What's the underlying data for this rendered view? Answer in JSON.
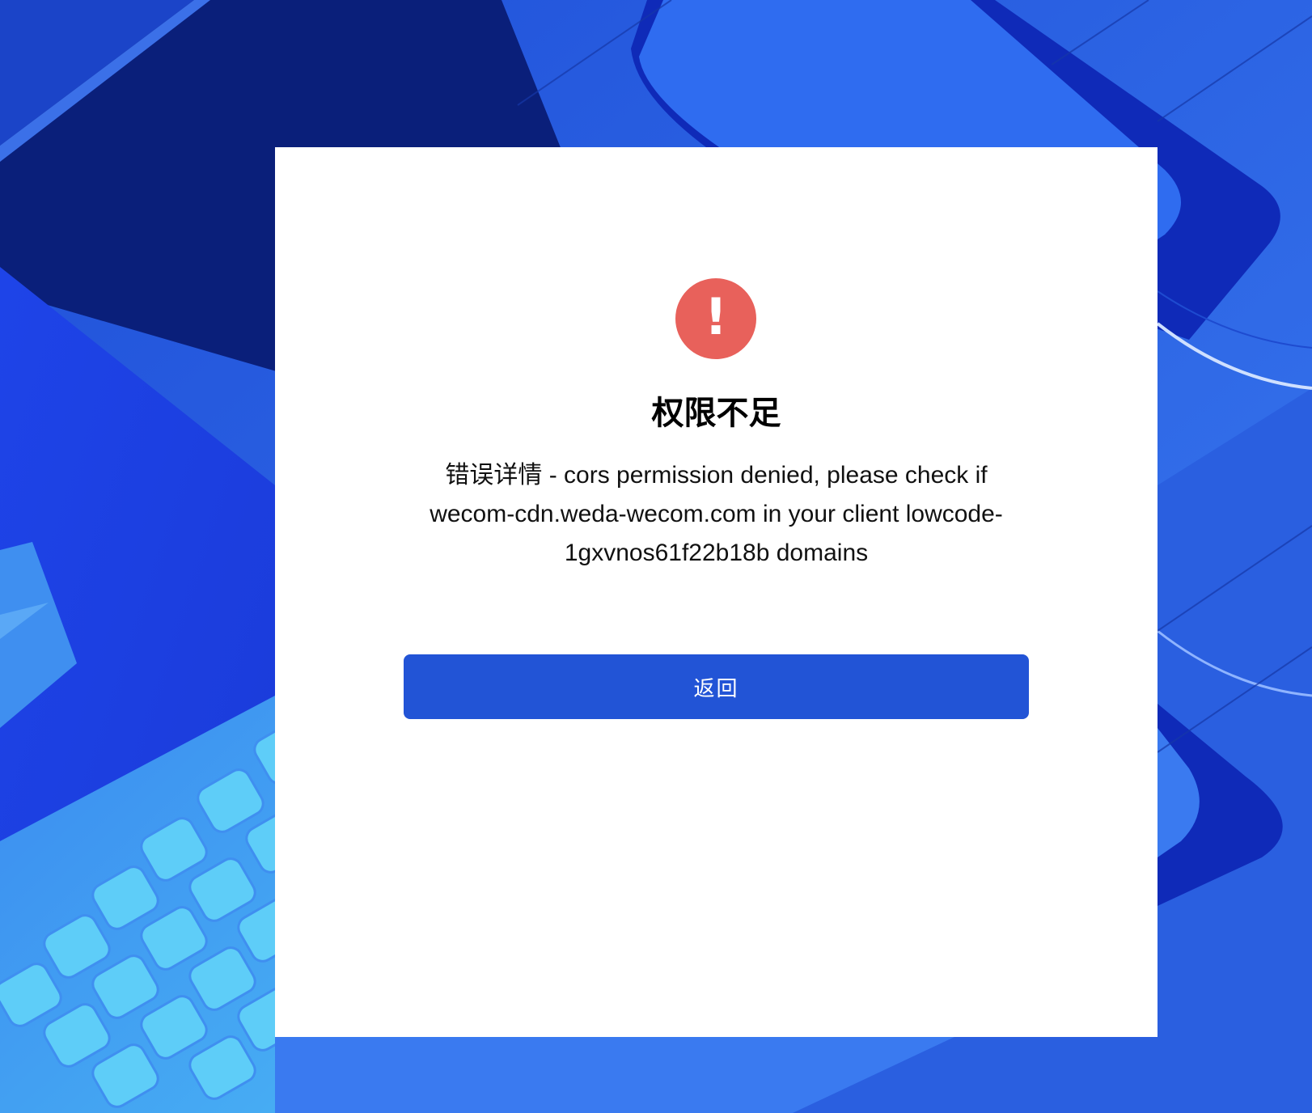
{
  "dialog": {
    "icon": "exclamation-alert-icon",
    "icon_glyph": "!",
    "title": "权限不足",
    "detail": "错误详情 - cors permission denied, please check if wecom-cdn.weda-wecom.com in your client lowcode-1gxvnos61f22b18b domains",
    "back_label": "返回"
  },
  "colors": {
    "alert": "#e8615b",
    "button": "#2254d6",
    "background_primary": "#2a5fe0",
    "background_dark": "#0a1f7a",
    "keyboard_keys": "#5ecdf8"
  }
}
